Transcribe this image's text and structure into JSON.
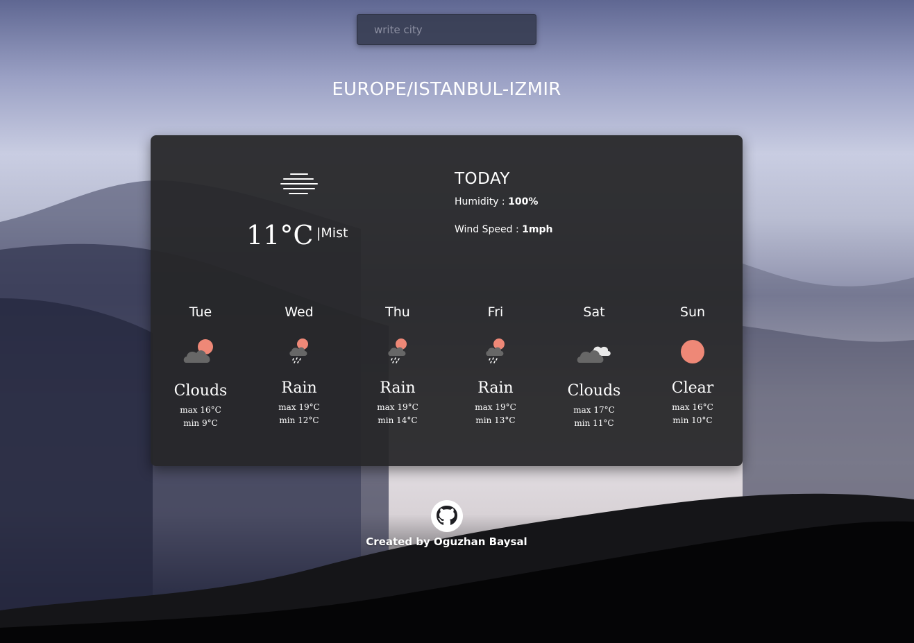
{
  "search": {
    "placeholder": "write city"
  },
  "location": "EUROPE/ISTANBUL-IZMIR",
  "current": {
    "temperature": "11°C",
    "description": "|Mist",
    "icon": "mist-icon"
  },
  "today": {
    "title": "TODAY",
    "humidity_label": "Humidity : ",
    "humidity_value": "100%",
    "wind_label": "Wind Speed : ",
    "wind_value": "1mph"
  },
  "forecast": [
    {
      "day": "Tue",
      "condition": "Clouds",
      "max": "max 16°C",
      "min": "min 9°C",
      "icon": "sun-behind-cloud-icon"
    },
    {
      "day": "Wed",
      "condition": "Rain",
      "max": "max 19°C",
      "min": "min 12°C",
      "icon": "sun-cloud-rain-icon"
    },
    {
      "day": "Thu",
      "condition": "Rain",
      "max": "max 19°C",
      "min": "min 14°C",
      "icon": "sun-cloud-rain-icon"
    },
    {
      "day": "Fri",
      "condition": "Rain",
      "max": "max 19°C",
      "min": "min 13°C",
      "icon": "sun-cloud-rain-icon"
    },
    {
      "day": "Sat",
      "condition": "Clouds",
      "max": "max 17°C",
      "min": "min 11°C",
      "icon": "clouds-icon"
    },
    {
      "day": "Sun",
      "condition": "Clear",
      "max": "max 16°C",
      "min": "min 10°C",
      "icon": "sun-icon"
    }
  ],
  "footer": {
    "credit": "Created by Oguzhan Baysal",
    "icon": "github-icon"
  },
  "colors": {
    "sun": "#ee8877",
    "cloud": "#676767",
    "card": "#262628"
  }
}
